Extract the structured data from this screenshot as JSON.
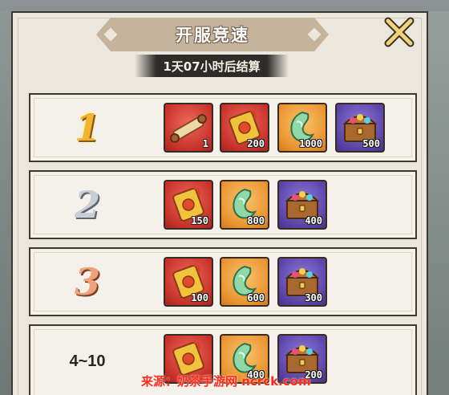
{
  "panel": {
    "title": "开服竞速",
    "timer": "1天07小时后结算",
    "close_icon": "close-x-icon"
  },
  "rows": [
    {
      "rank": "1",
      "items": [
        {
          "kind": "scroll-item",
          "color": "red",
          "qty": "1"
        },
        {
          "kind": "red-envelope-item",
          "color": "red",
          "qty": "200"
        },
        {
          "kind": "jade-item",
          "color": "orange",
          "qty": "1000"
        },
        {
          "kind": "treasure-chest-item",
          "color": "purple",
          "qty": "500"
        }
      ]
    },
    {
      "rank": "2",
      "items": [
        {
          "kind": "red-envelope-item",
          "color": "red",
          "qty": "150"
        },
        {
          "kind": "jade-item",
          "color": "orange",
          "qty": "800"
        },
        {
          "kind": "treasure-chest-item",
          "color": "purple",
          "qty": "400"
        }
      ]
    },
    {
      "rank": "3",
      "items": [
        {
          "kind": "red-envelope-item",
          "color": "red",
          "qty": "100"
        },
        {
          "kind": "jade-item",
          "color": "orange",
          "qty": "600"
        },
        {
          "kind": "treasure-chest-item",
          "color": "purple",
          "qty": "300"
        }
      ]
    },
    {
      "rank": "4~10",
      "items": [
        {
          "kind": "red-envelope-item",
          "color": "red",
          "qty": ""
        },
        {
          "kind": "jade-item",
          "color": "orange",
          "qty": "400"
        },
        {
          "kind": "treasure-chest-item",
          "color": "purple",
          "qty": "200"
        }
      ]
    }
  ],
  "watermark": "来源：奶茶手游网 ncrck.com"
}
